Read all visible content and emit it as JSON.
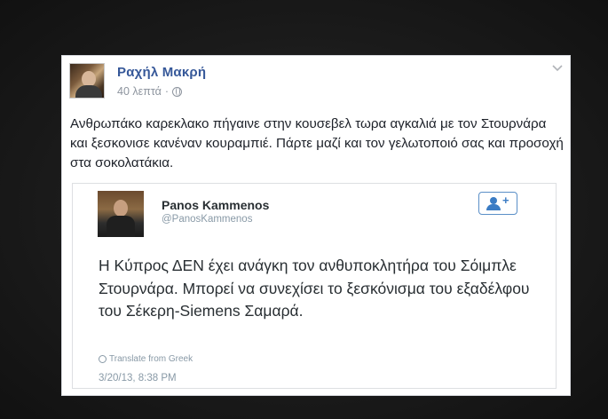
{
  "post": {
    "author": "Ραχήλ Μακρή",
    "time": "40 λεπτά",
    "separator": "·",
    "text": "Ανθρωπάκο καρεκλακο πήγαινε στην κουσεβελ τωρα αγκαλιά με τον Στουρνάρα και ξεσκονισε κανέναν κουραμπιέ. Πάρτε μαζί και τον γελωτοποιό σας και προσοχή στα σοκολατάκια.",
    "menu_icon": "chevron-down-icon",
    "privacy_icon": "globe-icon"
  },
  "tweet": {
    "name": "Panos Kammenos",
    "handle": "@PanosKammenos",
    "text": "Η Κύπρος ΔΕΝ έχει ανάγκη τον ανθυποκλητήρα του Σόιμπλε Στουρνάρα. Μπορεί να συνεχίσει το ξεσκόνισμα του εξαδέλφου του Σέκερη-Siemens Σαμαρά.",
    "translate_label": "Translate from Greek",
    "date": "3/20/13, 8:38 PM",
    "follow_icon": "follow-user-icon",
    "follow_plus": "+"
  }
}
